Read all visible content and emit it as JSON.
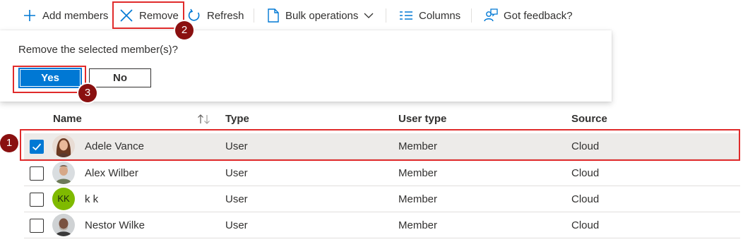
{
  "toolbar": {
    "add_members": "Add members",
    "remove": "Remove",
    "refresh": "Refresh",
    "bulk_operations": "Bulk operations",
    "columns": "Columns",
    "feedback": "Got feedback?"
  },
  "popup": {
    "message": "Remove the selected member(s)?",
    "yes_label": "Yes",
    "no_label": "No"
  },
  "table": {
    "headers": {
      "name": "Name",
      "type": "Type",
      "user_type": "User type",
      "source": "Source"
    },
    "rows": [
      {
        "name": "Adele Vance",
        "type": "User",
        "user_type": "Member",
        "source": "Cloud",
        "selected": true
      },
      {
        "name": "Alex Wilber",
        "type": "User",
        "user_type": "Member",
        "source": "Cloud",
        "selected": false
      },
      {
        "name": "k k",
        "type": "User",
        "user_type": "Member",
        "source": "Cloud",
        "selected": false,
        "initials": "KK"
      },
      {
        "name": "Nestor Wilke",
        "type": "User",
        "user_type": "Member",
        "source": "Cloud",
        "selected": false
      }
    ]
  },
  "annotations": {
    "step1": "1",
    "step2": "2",
    "step3": "3"
  },
  "colors": {
    "accent": "#0078d4",
    "highlight": "#e02b2b",
    "badge": "#8a1010",
    "initials_bg": "#7fba00"
  },
  "icons": [
    "plus-icon",
    "close-icon",
    "refresh-icon",
    "document-icon",
    "chevron-down-icon",
    "columns-icon",
    "feedback-icon",
    "sort-icon",
    "checkmark-icon"
  ]
}
